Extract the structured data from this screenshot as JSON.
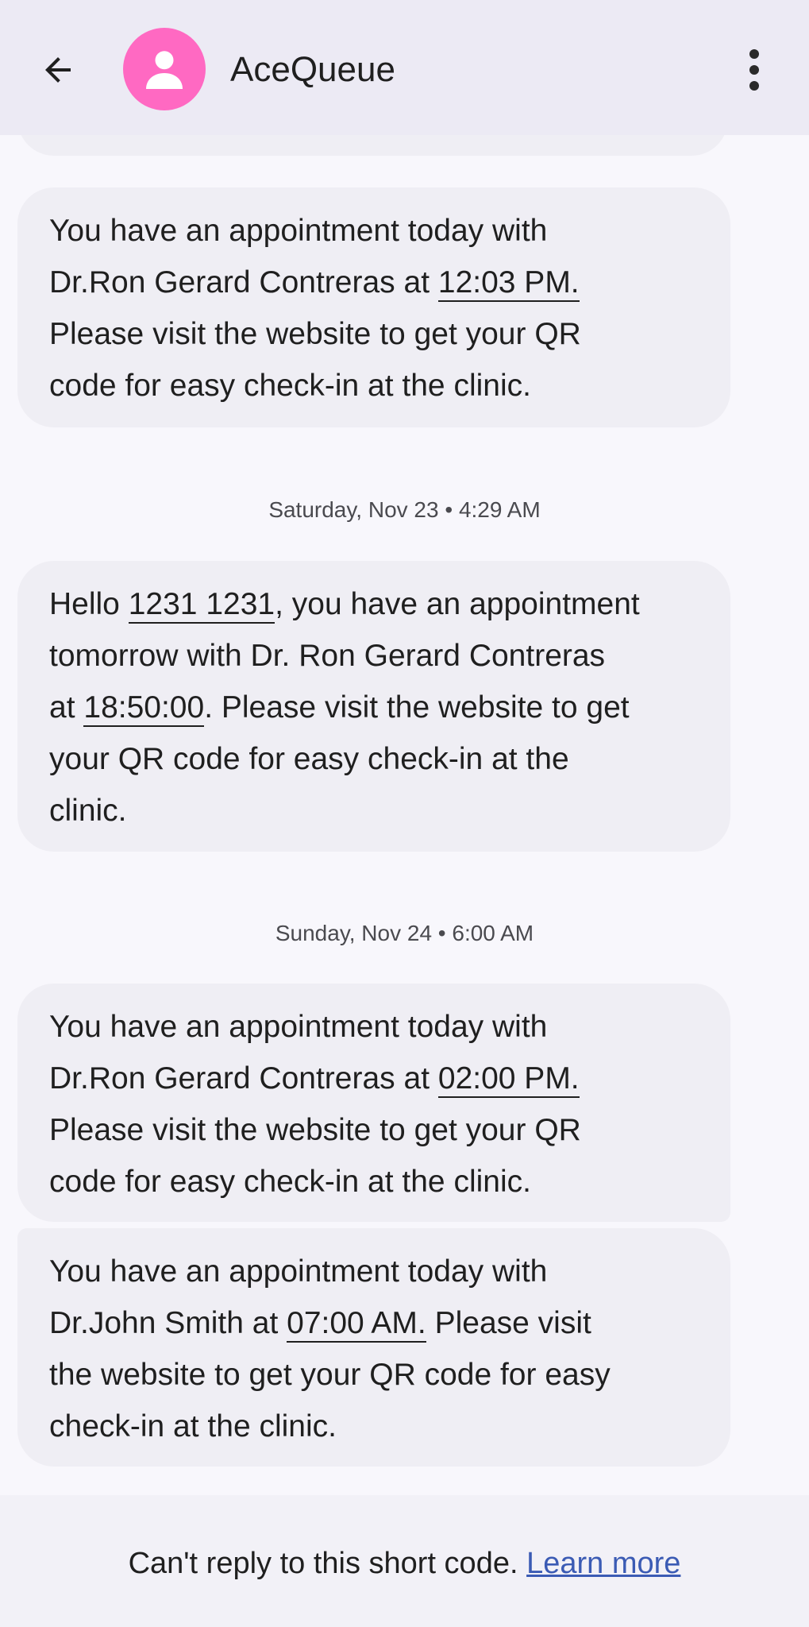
{
  "header": {
    "title": "AceQueue",
    "avatar_color": "#ff69c2",
    "back_icon": "arrow-back-icon",
    "menu_icon": "more-vert-icon"
  },
  "messages": [
    {
      "lines": [
        {
          "parts": [
            "You have an appointment today with"
          ]
        },
        {
          "parts": [
            "Dr.Ron Gerard Contreras at "
          ],
          "link": "12:03 PM."
        },
        {
          "parts": [
            "Please visit the website to get your QR"
          ]
        },
        {
          "parts": [
            "code for easy check-in at the clinic."
          ]
        }
      ]
    },
    {
      "timestamp": "Saturday, Nov 23 • 4:29 AM",
      "lines": [
        {
          "parts": [
            "Hello "
          ],
          "link": "1231 1231",
          "after": ", you have an appointment"
        },
        {
          "parts": [
            "tomorrow with Dr. Ron Gerard Contreras"
          ]
        },
        {
          "parts": [
            "at "
          ],
          "link": "18:50:00",
          "after": ". Please visit the website to get"
        },
        {
          "parts": [
            "your QR code for easy check-in at the"
          ]
        },
        {
          "parts": [
            "clinic."
          ]
        }
      ]
    },
    {
      "timestamp": "Sunday, Nov 24 • 6:00 AM",
      "lines": [
        {
          "parts": [
            "You have an appointment today with"
          ]
        },
        {
          "parts": [
            "Dr.Ron Gerard Contreras at "
          ],
          "link": "02:00 PM."
        },
        {
          "parts": [
            "Please visit the website to get your QR"
          ]
        },
        {
          "parts": [
            "code for easy check-in at the clinic."
          ]
        }
      ]
    },
    {
      "lines": [
        {
          "parts": [
            "You have an appointment today with"
          ]
        },
        {
          "parts": [
            "Dr.John Smith at "
          ],
          "link": "07:00 AM.",
          "after": " Please visit"
        },
        {
          "parts": [
            "the website to get your QR code for easy"
          ]
        },
        {
          "parts": [
            "check-in at the clinic."
          ]
        }
      ]
    }
  ],
  "footer": {
    "text": "Can't reply to this short code.",
    "link_label": "Learn more",
    "link_color": "#3b5bb4"
  }
}
